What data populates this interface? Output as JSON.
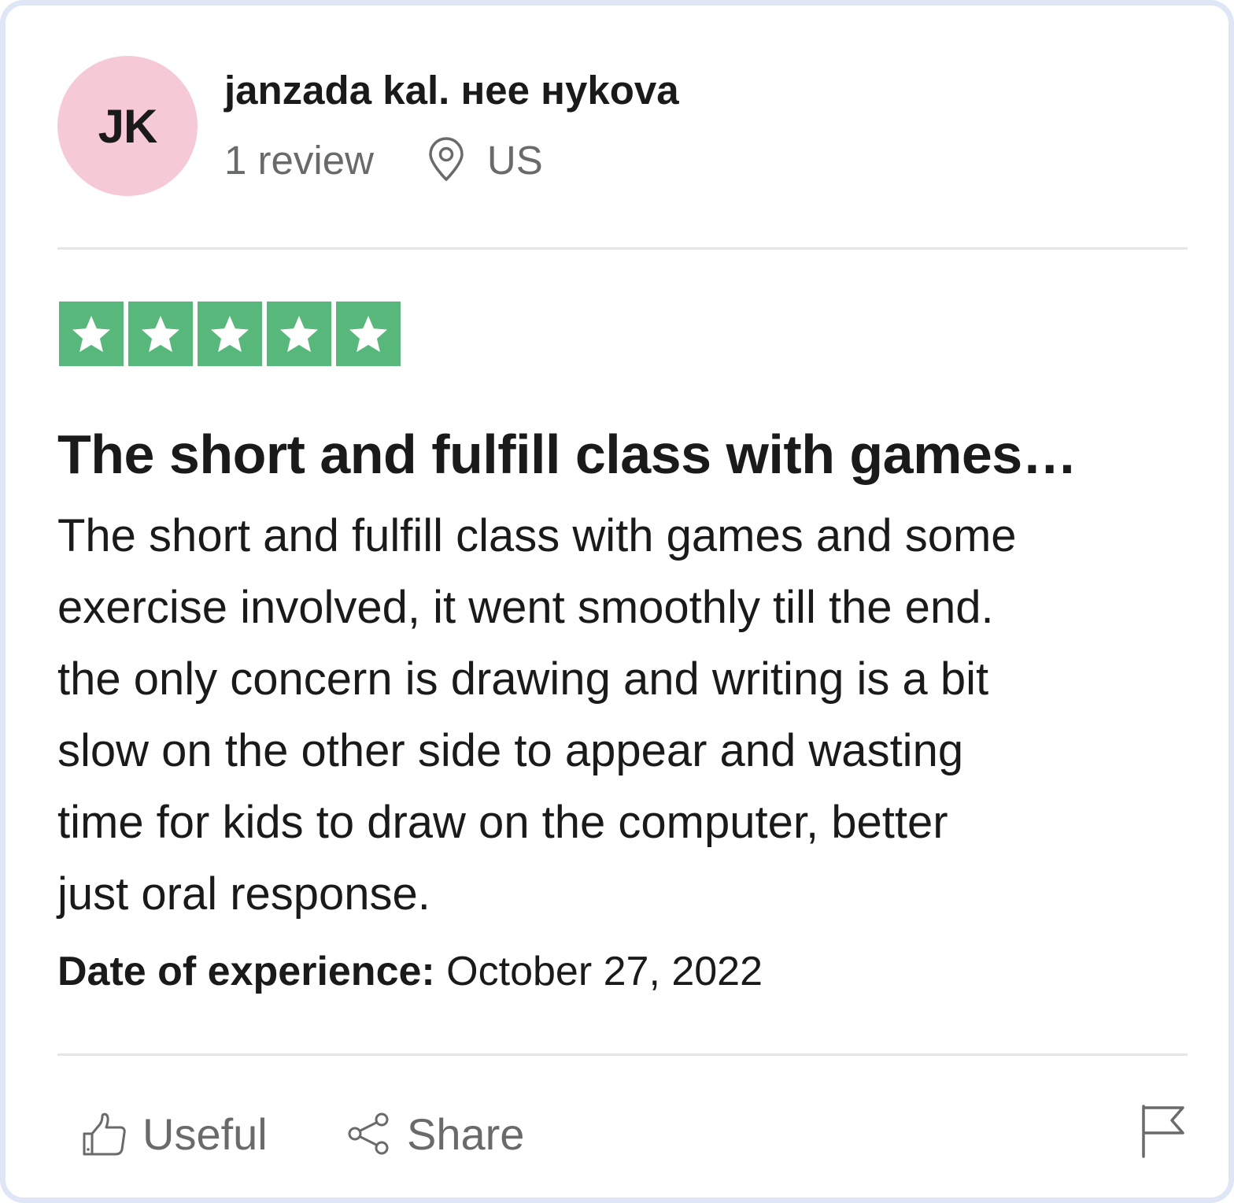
{
  "reviewer": {
    "initials": "JK",
    "name": "janzada kal. нее нykova",
    "review_count": "1 review",
    "location_icon": "map-pin-icon",
    "country": "US",
    "avatar_color": "#f6c9d7"
  },
  "rating": {
    "stars": 5,
    "max_stars": 5,
    "star_color": "#58b87c",
    "star_icon": "star-icon"
  },
  "review": {
    "title": "The short and fulfill class with games…",
    "body_lines": [
      "The short and fulfill class with games and some",
      "exercise involved, it went smoothly till the end.",
      "the only concern is drawing and writing is a bit",
      "slow on the other side to appear and wasting",
      "time for kids to draw on the computer, better",
      "just oral response."
    ],
    "date_label": "Date of experience:",
    "date_value": " October 27, 2022"
  },
  "actions": {
    "useful_label": "Useful",
    "useful_icon": "thumbs-up-icon",
    "share_label": "Share",
    "share_icon": "share-icon",
    "flag_icon": "flag-icon"
  }
}
